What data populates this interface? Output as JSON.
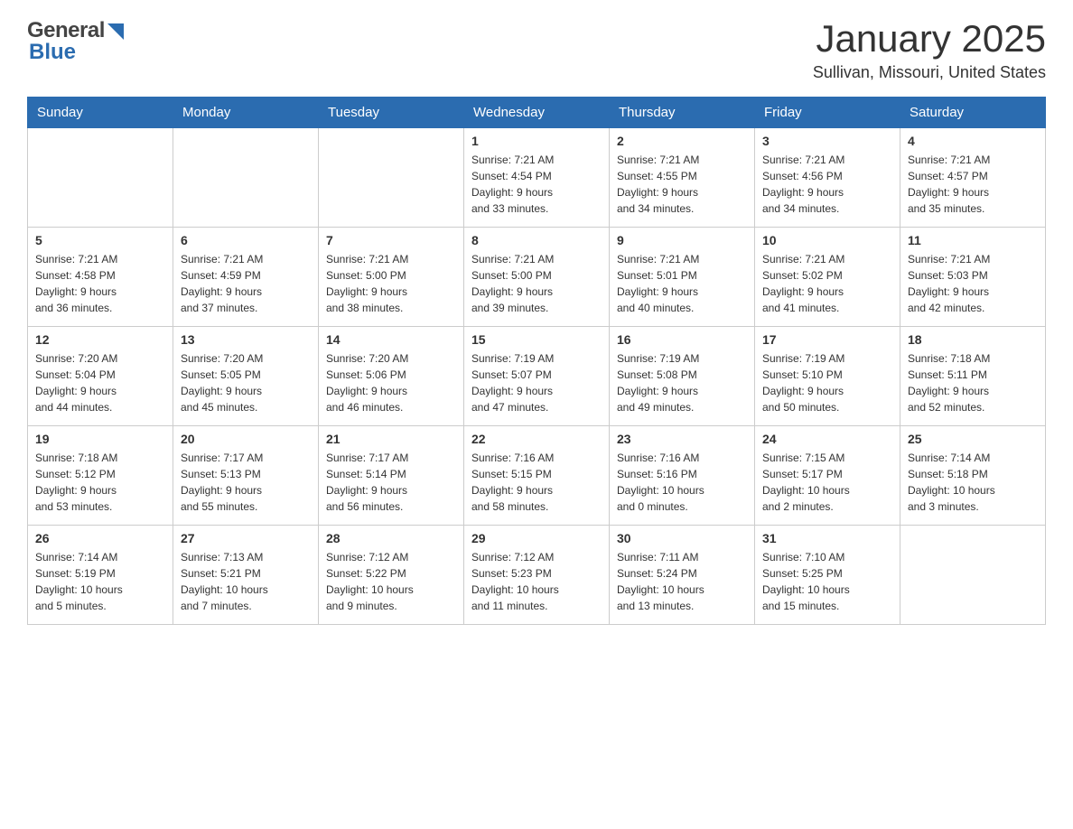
{
  "header": {
    "logo_general": "General",
    "logo_blue": "Blue",
    "month": "January 2025",
    "location": "Sullivan, Missouri, United States"
  },
  "days_of_week": [
    "Sunday",
    "Monday",
    "Tuesday",
    "Wednesday",
    "Thursday",
    "Friday",
    "Saturday"
  ],
  "weeks": [
    [
      {
        "day": "",
        "info": ""
      },
      {
        "day": "",
        "info": ""
      },
      {
        "day": "",
        "info": ""
      },
      {
        "day": "1",
        "info": "Sunrise: 7:21 AM\nSunset: 4:54 PM\nDaylight: 9 hours\nand 33 minutes."
      },
      {
        "day": "2",
        "info": "Sunrise: 7:21 AM\nSunset: 4:55 PM\nDaylight: 9 hours\nand 34 minutes."
      },
      {
        "day": "3",
        "info": "Sunrise: 7:21 AM\nSunset: 4:56 PM\nDaylight: 9 hours\nand 34 minutes."
      },
      {
        "day": "4",
        "info": "Sunrise: 7:21 AM\nSunset: 4:57 PM\nDaylight: 9 hours\nand 35 minutes."
      }
    ],
    [
      {
        "day": "5",
        "info": "Sunrise: 7:21 AM\nSunset: 4:58 PM\nDaylight: 9 hours\nand 36 minutes."
      },
      {
        "day": "6",
        "info": "Sunrise: 7:21 AM\nSunset: 4:59 PM\nDaylight: 9 hours\nand 37 minutes."
      },
      {
        "day": "7",
        "info": "Sunrise: 7:21 AM\nSunset: 5:00 PM\nDaylight: 9 hours\nand 38 minutes."
      },
      {
        "day": "8",
        "info": "Sunrise: 7:21 AM\nSunset: 5:00 PM\nDaylight: 9 hours\nand 39 minutes."
      },
      {
        "day": "9",
        "info": "Sunrise: 7:21 AM\nSunset: 5:01 PM\nDaylight: 9 hours\nand 40 minutes."
      },
      {
        "day": "10",
        "info": "Sunrise: 7:21 AM\nSunset: 5:02 PM\nDaylight: 9 hours\nand 41 minutes."
      },
      {
        "day": "11",
        "info": "Sunrise: 7:21 AM\nSunset: 5:03 PM\nDaylight: 9 hours\nand 42 minutes."
      }
    ],
    [
      {
        "day": "12",
        "info": "Sunrise: 7:20 AM\nSunset: 5:04 PM\nDaylight: 9 hours\nand 44 minutes."
      },
      {
        "day": "13",
        "info": "Sunrise: 7:20 AM\nSunset: 5:05 PM\nDaylight: 9 hours\nand 45 minutes."
      },
      {
        "day": "14",
        "info": "Sunrise: 7:20 AM\nSunset: 5:06 PM\nDaylight: 9 hours\nand 46 minutes."
      },
      {
        "day": "15",
        "info": "Sunrise: 7:19 AM\nSunset: 5:07 PM\nDaylight: 9 hours\nand 47 minutes."
      },
      {
        "day": "16",
        "info": "Sunrise: 7:19 AM\nSunset: 5:08 PM\nDaylight: 9 hours\nand 49 minutes."
      },
      {
        "day": "17",
        "info": "Sunrise: 7:19 AM\nSunset: 5:10 PM\nDaylight: 9 hours\nand 50 minutes."
      },
      {
        "day": "18",
        "info": "Sunrise: 7:18 AM\nSunset: 5:11 PM\nDaylight: 9 hours\nand 52 minutes."
      }
    ],
    [
      {
        "day": "19",
        "info": "Sunrise: 7:18 AM\nSunset: 5:12 PM\nDaylight: 9 hours\nand 53 minutes."
      },
      {
        "day": "20",
        "info": "Sunrise: 7:17 AM\nSunset: 5:13 PM\nDaylight: 9 hours\nand 55 minutes."
      },
      {
        "day": "21",
        "info": "Sunrise: 7:17 AM\nSunset: 5:14 PM\nDaylight: 9 hours\nand 56 minutes."
      },
      {
        "day": "22",
        "info": "Sunrise: 7:16 AM\nSunset: 5:15 PM\nDaylight: 9 hours\nand 58 minutes."
      },
      {
        "day": "23",
        "info": "Sunrise: 7:16 AM\nSunset: 5:16 PM\nDaylight: 10 hours\nand 0 minutes."
      },
      {
        "day": "24",
        "info": "Sunrise: 7:15 AM\nSunset: 5:17 PM\nDaylight: 10 hours\nand 2 minutes."
      },
      {
        "day": "25",
        "info": "Sunrise: 7:14 AM\nSunset: 5:18 PM\nDaylight: 10 hours\nand 3 minutes."
      }
    ],
    [
      {
        "day": "26",
        "info": "Sunrise: 7:14 AM\nSunset: 5:19 PM\nDaylight: 10 hours\nand 5 minutes."
      },
      {
        "day": "27",
        "info": "Sunrise: 7:13 AM\nSunset: 5:21 PM\nDaylight: 10 hours\nand 7 minutes."
      },
      {
        "day": "28",
        "info": "Sunrise: 7:12 AM\nSunset: 5:22 PM\nDaylight: 10 hours\nand 9 minutes."
      },
      {
        "day": "29",
        "info": "Sunrise: 7:12 AM\nSunset: 5:23 PM\nDaylight: 10 hours\nand 11 minutes."
      },
      {
        "day": "30",
        "info": "Sunrise: 7:11 AM\nSunset: 5:24 PM\nDaylight: 10 hours\nand 13 minutes."
      },
      {
        "day": "31",
        "info": "Sunrise: 7:10 AM\nSunset: 5:25 PM\nDaylight: 10 hours\nand 15 minutes."
      },
      {
        "day": "",
        "info": ""
      }
    ]
  ]
}
